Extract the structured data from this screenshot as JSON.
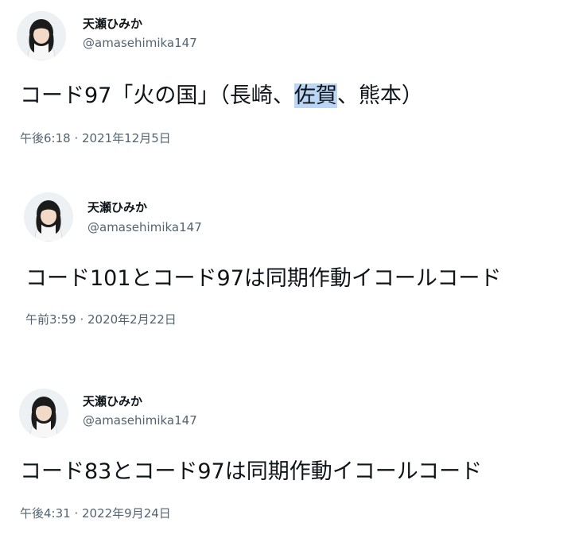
{
  "tweets": [
    {
      "display_name": "天瀬ひみか",
      "handle": "@amasehimika147",
      "text_before": "コード97「火の国」（長崎、",
      "text_highlight": "佐賀",
      "text_after": "、熊本）",
      "timestamp": "午後6:18 · 2021年12月5日"
    },
    {
      "display_name": "天瀬ひみか",
      "handle": "@amasehimika147",
      "text": "コード101とコード97は同期作動イコールコード",
      "timestamp": "午前3:59 · 2020年2月22日"
    },
    {
      "display_name": "天瀬ひみか",
      "handle": "@amasehimika147",
      "text": "コード83とコード97は同期作動イコールコード",
      "timestamp": "午後4:31 · 2022年9月24日"
    }
  ],
  "colors": {
    "text": "#0f1419",
    "secondary": "#536471",
    "highlight": "#bcd6f6"
  },
  "icons": {
    "avatar": "profile-photo-girl"
  }
}
